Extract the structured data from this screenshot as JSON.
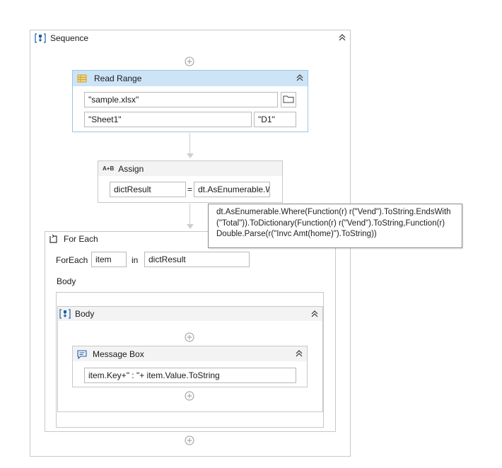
{
  "sequence": {
    "title": "Sequence"
  },
  "read_range": {
    "title": "Read Range",
    "workbook": "\"sample.xlsx\"",
    "sheet": "\"Sheet1\"",
    "range": "\"D1\""
  },
  "assign": {
    "title": "Assign",
    "icon_text": "A+B",
    "to": "dictResult",
    "equals": "=",
    "value": "dt.AsEnumerable.W"
  },
  "tooltip": {
    "text": "dt.AsEnumerable.Where(Function(r) r(\"Vend\").ToString.EndsWith\n(\"Total\")).ToDictionary(Function(r) r(\"Vend\").ToString,Function(r)\nDouble.Parse(r(\"Invc Amt(home)\").ToString))"
  },
  "for_each": {
    "title": "For Each",
    "foreach_label": "ForEach",
    "item": "item",
    "in_label": "in",
    "collection": "dictResult",
    "body_label": "Body"
  },
  "body": {
    "title": "Body"
  },
  "message_box": {
    "title": "Message Box",
    "text": "item.Key+\" : \"+ item.Value.ToString"
  }
}
